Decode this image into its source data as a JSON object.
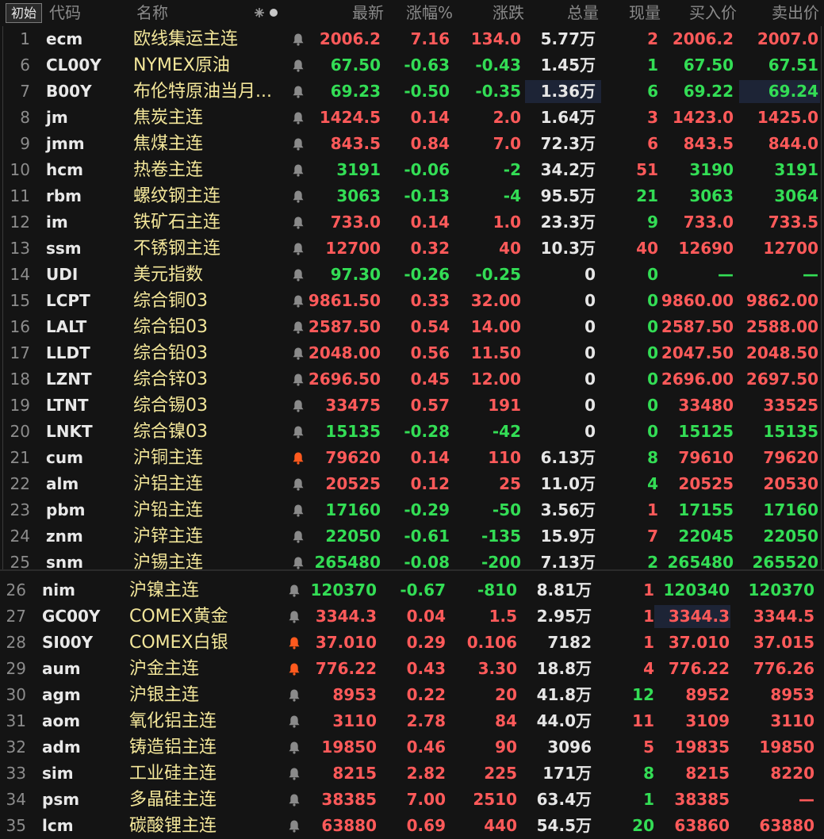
{
  "header": {
    "tag_button": "初始",
    "columns": [
      "代码",
      "名称",
      "最新",
      "涨幅%",
      "涨跌",
      "总量",
      "现量",
      "买入价",
      "卖出价"
    ]
  },
  "rows": [
    {
      "idx": "1",
      "code": "ecm",
      "name": "欧线集运主连",
      "last": "2006.2",
      "pct": "7.16",
      "chg": "134.0",
      "vol": "5.77万",
      "cur": "2",
      "bid": "2006.2",
      "ask": "2007.0",
      "dir": "up",
      "bell": "grey"
    },
    {
      "idx": "6",
      "code": "CL00Y",
      "name": "NYMEX原油",
      "last": "67.50",
      "pct": "-0.63",
      "chg": "-0.43",
      "vol": "1.45万",
      "cur": "1",
      "bid": "67.50",
      "ask": "67.51",
      "dir": "down",
      "bell": "grey"
    },
    {
      "idx": "7",
      "code": "B00Y",
      "name": "布伦特原油当月...",
      "last": "69.23",
      "pct": "-0.50",
      "chg": "-0.35",
      "vol": "1.36万",
      "cur": "6",
      "bid": "69.22",
      "ask": "69.24",
      "dir": "down",
      "bell": "grey",
      "hl_vol": true,
      "hl_ask": true
    },
    {
      "idx": "8",
      "code": "jm",
      "name": "焦炭主连",
      "last": "1424.5",
      "pct": "0.14",
      "chg": "2.0",
      "vol": "1.64万",
      "cur": "3",
      "bid": "1423.0",
      "ask": "1425.0",
      "dir": "up",
      "bell": "grey"
    },
    {
      "idx": "9",
      "code": "jmm",
      "name": "焦煤主连",
      "last": "843.5",
      "pct": "0.84",
      "chg": "7.0",
      "vol": "72.3万",
      "cur": "6",
      "bid": "843.5",
      "ask": "844.0",
      "dir": "up",
      "bell": "grey"
    },
    {
      "idx": "10",
      "code": "hcm",
      "name": "热卷主连",
      "last": "3191",
      "pct": "-0.06",
      "chg": "-2",
      "vol": "34.2万",
      "cur": "51",
      "bid": "3190",
      "ask": "3191",
      "dir": "down",
      "bell": "grey",
      "cur_dir": "up"
    },
    {
      "idx": "11",
      "code": "rbm",
      "name": "螺纹钢主连",
      "last": "3063",
      "pct": "-0.13",
      "chg": "-4",
      "vol": "95.5万",
      "cur": "21",
      "bid": "3063",
      "ask": "3064",
      "dir": "down",
      "bell": "grey"
    },
    {
      "idx": "12",
      "code": "im",
      "name": "铁矿石主连",
      "last": "733.0",
      "pct": "0.14",
      "chg": "1.0",
      "vol": "23.3万",
      "cur": "9",
      "bid": "733.0",
      "ask": "733.5",
      "dir": "up",
      "bell": "grey",
      "cur_dir": "down"
    },
    {
      "idx": "13",
      "code": "ssm",
      "name": "不锈钢主连",
      "last": "12700",
      "pct": "0.32",
      "chg": "40",
      "vol": "10.3万",
      "cur": "40",
      "bid": "12690",
      "ask": "12700",
      "dir": "up",
      "bell": "grey"
    },
    {
      "idx": "14",
      "code": "UDI",
      "name": "美元指数",
      "last": "97.30",
      "pct": "-0.26",
      "chg": "-0.25",
      "vol": "0",
      "cur": "0",
      "bid": "—",
      "ask": "—",
      "dir": "down",
      "bell": "grey",
      "cur_dir": "down"
    },
    {
      "idx": "15",
      "code": "LCPT",
      "name": "综合铜03",
      "last": "9861.50",
      "pct": "0.33",
      "chg": "32.00",
      "vol": "0",
      "cur": "0",
      "bid": "9860.00",
      "ask": "9862.00",
      "dir": "up",
      "bell": "grey"
    },
    {
      "idx": "16",
      "code": "LALT",
      "name": "综合铝03",
      "last": "2587.50",
      "pct": "0.54",
      "chg": "14.00",
      "vol": "0",
      "cur": "0",
      "bid": "2587.50",
      "ask": "2588.00",
      "dir": "up",
      "bell": "grey",
      "cur_dir": "down"
    },
    {
      "idx": "17",
      "code": "LLDT",
      "name": "综合铅03",
      "last": "2048.00",
      "pct": "0.56",
      "chg": "11.50",
      "vol": "0",
      "cur": "0",
      "bid": "2047.50",
      "ask": "2048.50",
      "dir": "up",
      "bell": "grey"
    },
    {
      "idx": "18",
      "code": "LZNT",
      "name": "综合锌03",
      "last": "2696.50",
      "pct": "0.45",
      "chg": "12.00",
      "vol": "0",
      "cur": "0",
      "bid": "2696.00",
      "ask": "2697.50",
      "dir": "up",
      "bell": "grey"
    },
    {
      "idx": "19",
      "code": "LTNT",
      "name": "综合锡03",
      "last": "33475",
      "pct": "0.57",
      "chg": "191",
      "vol": "0",
      "cur": "0",
      "bid": "33480",
      "ask": "33525",
      "dir": "up",
      "bell": "grey"
    },
    {
      "idx": "20",
      "code": "LNKT",
      "name": "综合镍03",
      "last": "15135",
      "pct": "-0.28",
      "chg": "-42",
      "vol": "0",
      "cur": "0",
      "bid": "15125",
      "ask": "15135",
      "dir": "down",
      "bell": "grey"
    },
    {
      "idx": "21",
      "code": "cum",
      "name": "沪铜主连",
      "last": "79620",
      "pct": "0.14",
      "chg": "110",
      "vol": "6.13万",
      "cur": "8",
      "bid": "79610",
      "ask": "79620",
      "dir": "up",
      "bell": "orange",
      "cur_dir": "down"
    },
    {
      "idx": "22",
      "code": "alm",
      "name": "沪铝主连",
      "last": "20525",
      "pct": "0.12",
      "chg": "25",
      "vol": "11.0万",
      "cur": "4",
      "bid": "20525",
      "ask": "20530",
      "dir": "up",
      "bell": "grey",
      "cur_dir": "down"
    },
    {
      "idx": "23",
      "code": "pbm",
      "name": "沪铅主连",
      "last": "17160",
      "pct": "-0.29",
      "chg": "-50",
      "vol": "3.56万",
      "cur": "1",
      "bid": "17155",
      "ask": "17160",
      "dir": "down",
      "bell": "grey",
      "cur_dir": "up"
    },
    {
      "idx": "24",
      "code": "znm",
      "name": "沪锌主连",
      "last": "22050",
      "pct": "-0.61",
      "chg": "-135",
      "vol": "15.9万",
      "cur": "7",
      "bid": "22045",
      "ask": "22050",
      "dir": "down",
      "bell": "grey",
      "cur_dir": "up"
    },
    {
      "idx": "25",
      "code": "snm",
      "name": "沪锡主连",
      "last": "265480",
      "pct": "-0.08",
      "chg": "-200",
      "vol": "7.13万",
      "cur": "2",
      "bid": "265480",
      "ask": "265520",
      "dir": "down",
      "bell": "grey"
    },
    {
      "idx": "26",
      "code": "nim",
      "name": "沪镍主连",
      "last": "120370",
      "pct": "-0.67",
      "chg": "-810",
      "vol": "8.81万",
      "cur": "1",
      "bid": "120340",
      "ask": "120370",
      "dir": "down",
      "bell": "grey",
      "cur_dir": "up"
    },
    {
      "idx": "27",
      "code": "GC00Y",
      "name": "COMEX黄金",
      "last": "3344.3",
      "pct": "0.04",
      "chg": "1.5",
      "vol": "2.95万",
      "cur": "1",
      "bid": "3344.3",
      "ask": "3344.5",
      "dir": "up",
      "bell": "grey",
      "hl_bid": true
    },
    {
      "idx": "28",
      "code": "SI00Y",
      "name": "COMEX白银",
      "last": "37.010",
      "pct": "0.29",
      "chg": "0.106",
      "vol": "7182",
      "cur": "1",
      "bid": "37.010",
      "ask": "37.015",
      "dir": "up",
      "bell": "orange"
    },
    {
      "idx": "29",
      "code": "aum",
      "name": "沪金主连",
      "last": "776.22",
      "pct": "0.43",
      "chg": "3.30",
      "vol": "18.8万",
      "cur": "4",
      "bid": "776.22",
      "ask": "776.26",
      "dir": "up",
      "bell": "orange"
    },
    {
      "idx": "30",
      "code": "agm",
      "name": "沪银主连",
      "last": "8953",
      "pct": "0.22",
      "chg": "20",
      "vol": "41.8万",
      "cur": "12",
      "bid": "8952",
      "ask": "8953",
      "dir": "up",
      "bell": "grey",
      "cur_dir": "down"
    },
    {
      "idx": "31",
      "code": "aom",
      "name": "氧化铝主连",
      "last": "3110",
      "pct": "2.78",
      "chg": "84",
      "vol": "44.0万",
      "cur": "11",
      "bid": "3109",
      "ask": "3110",
      "dir": "up",
      "bell": "grey"
    },
    {
      "idx": "32",
      "code": "adm",
      "name": "铸造铝主连",
      "last": "19850",
      "pct": "0.46",
      "chg": "90",
      "vol": "3096",
      "cur": "5",
      "bid": "19835",
      "ask": "19850",
      "dir": "up",
      "bell": "grey"
    },
    {
      "idx": "33",
      "code": "sim",
      "name": "工业硅主连",
      "last": "8215",
      "pct": "2.82",
      "chg": "225",
      "vol": "171万",
      "cur": "8",
      "bid": "8215",
      "ask": "8220",
      "dir": "up",
      "bell": "grey",
      "cur_dir": "down"
    },
    {
      "idx": "34",
      "code": "psm",
      "name": "多晶硅主连",
      "last": "38385",
      "pct": "7.00",
      "chg": "2510",
      "vol": "63.4万",
      "cur": "1",
      "bid": "38385",
      "ask": "—",
      "dir": "up",
      "bell": "grey",
      "cur_dir": "down"
    },
    {
      "idx": "35",
      "code": "lcm",
      "name": "碳酸锂主连",
      "last": "63880",
      "pct": "0.69",
      "chg": "440",
      "vol": "54.5万",
      "cur": "20",
      "bid": "63860",
      "ask": "63880",
      "dir": "up",
      "bell": "grey",
      "cur_dir": "down"
    }
  ],
  "colors": {
    "up": "#ff5a5a",
    "down": "#33dd55",
    "name": "#f4e79a",
    "bell_orange": "#ff5a1e",
    "bell_grey": "#8a8a8a"
  }
}
